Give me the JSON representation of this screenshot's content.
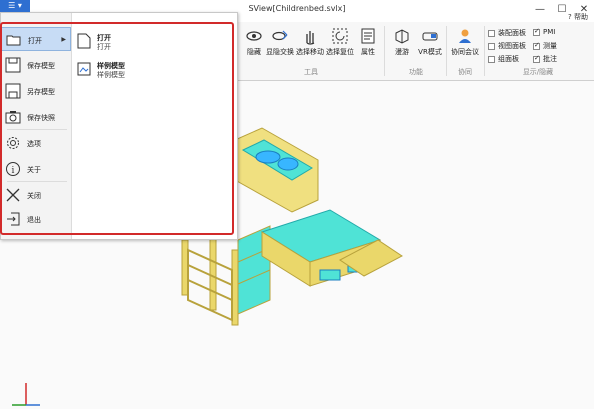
{
  "window": {
    "title": "SView[Childrenbed.svlx]",
    "minimize_label": "—",
    "maximize_label": "☐",
    "close_label": "✕"
  },
  "ribbon": {
    "help_label": "帮助",
    "tools": [
      {
        "label": "隐藏",
        "icon": "eye-icon"
      },
      {
        "label": "显隐交换",
        "icon": "swap-visibility-icon"
      },
      {
        "label": "选择移动",
        "icon": "hand-move-icon"
      },
      {
        "label": "选择复位",
        "icon": "reset-icon"
      },
      {
        "label": "属性",
        "icon": "properties-icon"
      }
    ],
    "tools_group": "工具",
    "function_tools": [
      {
        "label": "漫游",
        "icon": "walkthrough-icon"
      },
      {
        "label": "VR模式",
        "icon": "vr-goggles-icon"
      }
    ],
    "function_group": "功能",
    "collab_tools": [
      {
        "label": "协同会议",
        "icon": "meeting-icon"
      }
    ],
    "collab_group": "协同",
    "display_checks": [
      {
        "label": "装配面板",
        "checked": false
      },
      {
        "label": "视图面板",
        "checked": false
      },
      {
        "label": "组面板",
        "checked": false
      },
      {
        "label": "PMI",
        "checked": true
      },
      {
        "label": "测量",
        "checked": true
      },
      {
        "label": "批注",
        "checked": true
      }
    ],
    "display_group": "显示/隐藏"
  },
  "file_menu": {
    "items": [
      {
        "label": "打开",
        "icon": "folder-open-icon",
        "active": true
      },
      {
        "label": "保存模型",
        "icon": "save-icon"
      },
      {
        "label": "另存模型",
        "icon": "save-as-icon"
      },
      {
        "label": "保存快照",
        "icon": "camera-icon"
      },
      {
        "label": "选项",
        "icon": "gear-icon"
      },
      {
        "label": "关于",
        "icon": "info-icon"
      },
      {
        "label": "关闭",
        "icon": "close-icon"
      },
      {
        "label": "退出",
        "icon": "exit-icon"
      }
    ],
    "submenu": [
      {
        "title": "打开",
        "subtitle": "打开",
        "icon": "document-icon"
      },
      {
        "title": "样例模型",
        "subtitle": "样例模型",
        "icon": "sample-model-icon"
      }
    ]
  },
  "colors": {
    "accent": "#2e6fd1",
    "highlight": "#d22a2a",
    "bed_frame": "#e8d76a",
    "mattress": "#4fe3d6"
  }
}
